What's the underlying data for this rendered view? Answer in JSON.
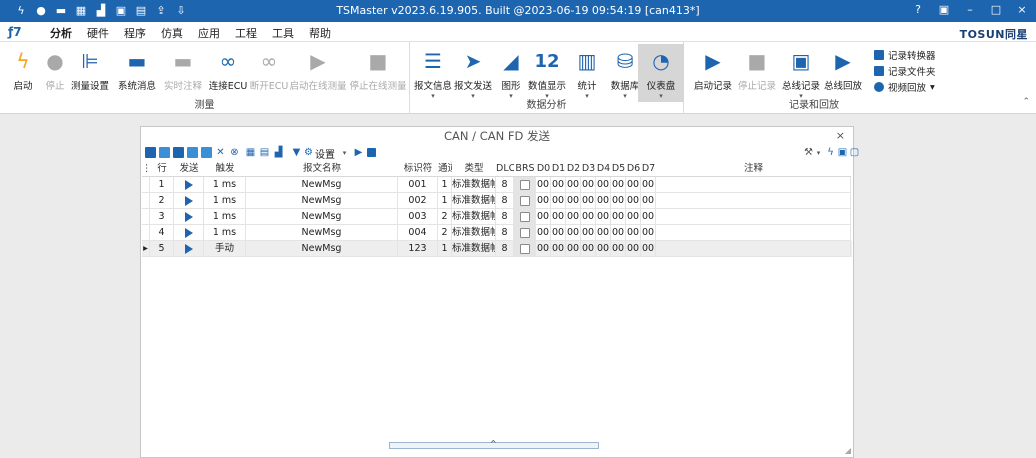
{
  "titlebar": {
    "title": "TSMaster v2023.6.19.905. Built @2023-06-19 09:54:19 [can413*]",
    "window_controls": [
      "?",
      "▣",
      "–",
      "□",
      "×"
    ]
  },
  "menubar": {
    "logo": "ƒ7",
    "items": [
      "分析",
      "硬件",
      "程序",
      "仿真",
      "应用",
      "工程",
      "工具",
      "帮助"
    ],
    "active": "分析",
    "brand": "TOSUN同星"
  },
  "ribbon": {
    "groups": {
      "measure": "测量",
      "analysis": "数据分析",
      "record": "记录和回放"
    },
    "buttons": {
      "start": "启动",
      "stop": "停止",
      "measure_setup": "测量设置",
      "system_msg": "系统消息",
      "realtime_comment": "实时注释",
      "connect_ecu": "连接ECU",
      "disconnect_ecu": "断开ECU",
      "start_online": "启动在线测量",
      "stop_online": "停止在线测量",
      "msg_info": "报文信息",
      "msg_send": "报文发送",
      "graph": "图形",
      "num_display": "数值显示",
      "stats": "统计",
      "database": "数据库",
      "dashboard": "仪表盘",
      "start_record": "启动记录",
      "stop_record": "停止记录",
      "bus_record": "总线记录",
      "bus_replay": "总线回放",
      "record_converter": "记录转换器",
      "record_folder": "记录文件夹",
      "video_replay": "视频回放"
    },
    "num_icon_text": "12"
  },
  "panel": {
    "title": "CAN / CAN FD 发送",
    "close": "×",
    "settings_label": "设置"
  },
  "table": {
    "headers": [
      "行",
      "发送",
      "触发",
      "报文名称",
      "标识符",
      "通道",
      "类型",
      "DLC",
      "BRS",
      "D0",
      "D1",
      "D2",
      "D3",
      "D4",
      "D5",
      "D6",
      "D7",
      "注释"
    ],
    "rows": [
      {
        "row": "1",
        "trigger": "1 ms",
        "name": "NewMsg",
        "id": "001",
        "ch": "1",
        "type": "标准数据帧",
        "dlc": "8",
        "d": [
          "00",
          "00",
          "00",
          "00",
          "00",
          "00",
          "00",
          "00"
        ]
      },
      {
        "row": "2",
        "trigger": "1 ms",
        "name": "NewMsg",
        "id": "002",
        "ch": "1",
        "type": "标准数据帧",
        "dlc": "8",
        "d": [
          "00",
          "00",
          "00",
          "00",
          "00",
          "00",
          "00",
          "00"
        ]
      },
      {
        "row": "3",
        "trigger": "1 ms",
        "name": "NewMsg",
        "id": "003",
        "ch": "2",
        "type": "标准数据帧",
        "dlc": "8",
        "d": [
          "00",
          "00",
          "00",
          "00",
          "00",
          "00",
          "00",
          "00"
        ]
      },
      {
        "row": "4",
        "trigger": "1 ms",
        "name": "NewMsg",
        "id": "004",
        "ch": "2",
        "type": "标准数据帧",
        "dlc": "8",
        "d": [
          "00",
          "00",
          "00",
          "00",
          "00",
          "00",
          "00",
          "00"
        ]
      },
      {
        "row": "5",
        "trigger": "手动",
        "name": "NewMsg",
        "id": "123",
        "ch": "1",
        "type": "标准数据帧",
        "dlc": "8",
        "d": [
          "00",
          "00",
          "00",
          "00",
          "00",
          "00",
          "00",
          "00"
        ]
      }
    ]
  }
}
